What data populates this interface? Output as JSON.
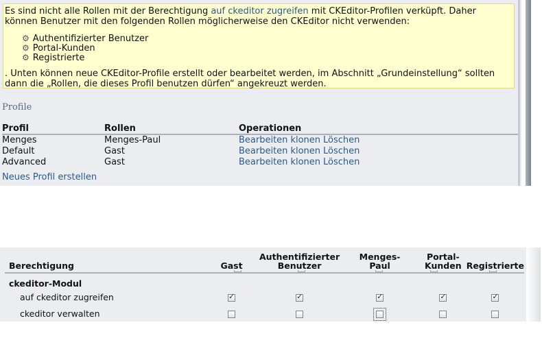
{
  "warning": {
    "text_before_link": "Es sind nicht alle Rollen mit der Berechtigung ",
    "link": "auf ckeditor zugreifen",
    "text_after_link": " mit CKEditor-Profilen verküpft. Daher können Benutzer mit den folgenden Rollen möglicherweise den CKEditor nicht verwenden:",
    "roles": [
      "Authentifizierter Benutzer",
      "Portal-Kunden",
      "Registrierte"
    ],
    "footer": ". Unten können neue CKEditor-Profile erstellt oder bearbeitet werden, im Abschnitt „Grundeinstellung“ sollten dann die „Rollen, die dieses Profil benutzen dürfen“ angekreuzt werden."
  },
  "profiles": {
    "heading": "Profile",
    "columns": [
      "Profil",
      "Rollen",
      "Operationen"
    ],
    "rows": [
      {
        "profil": "Menges",
        "rollen": "Menges-Paul",
        "ops": [
          "Bearbeiten",
          "klonen",
          "Löschen"
        ]
      },
      {
        "profil": "Default",
        "rollen": "Gast",
        "ops": [
          "Bearbeiten",
          "klonen",
          "Löschen"
        ]
      },
      {
        "profil": "Advanced",
        "rollen": "Gast",
        "ops": [
          "Bearbeiten",
          "klonen",
          "Löschen"
        ]
      }
    ],
    "new_profile_link": "Neues Profil erstellen"
  },
  "permissions": {
    "columns": {
      "permission": "Berechtigung",
      "gast": "Gast",
      "auth_1": "Authentifizierter",
      "auth_2": "Benutzer",
      "menges_1": "Menges-",
      "menges_2": "Paul",
      "portal_1": "Portal-",
      "portal_2": "Kunden",
      "registrierte": "Registrierte"
    },
    "module": "ckeditor-Modul",
    "rows": [
      {
        "name": "auf ckeditor zugreifen",
        "checked": [
          true,
          true,
          true,
          true,
          true
        ]
      },
      {
        "name": "ckeditor verwalten",
        "checked": [
          false,
          false,
          false,
          false,
          false
        ]
      }
    ]
  }
}
